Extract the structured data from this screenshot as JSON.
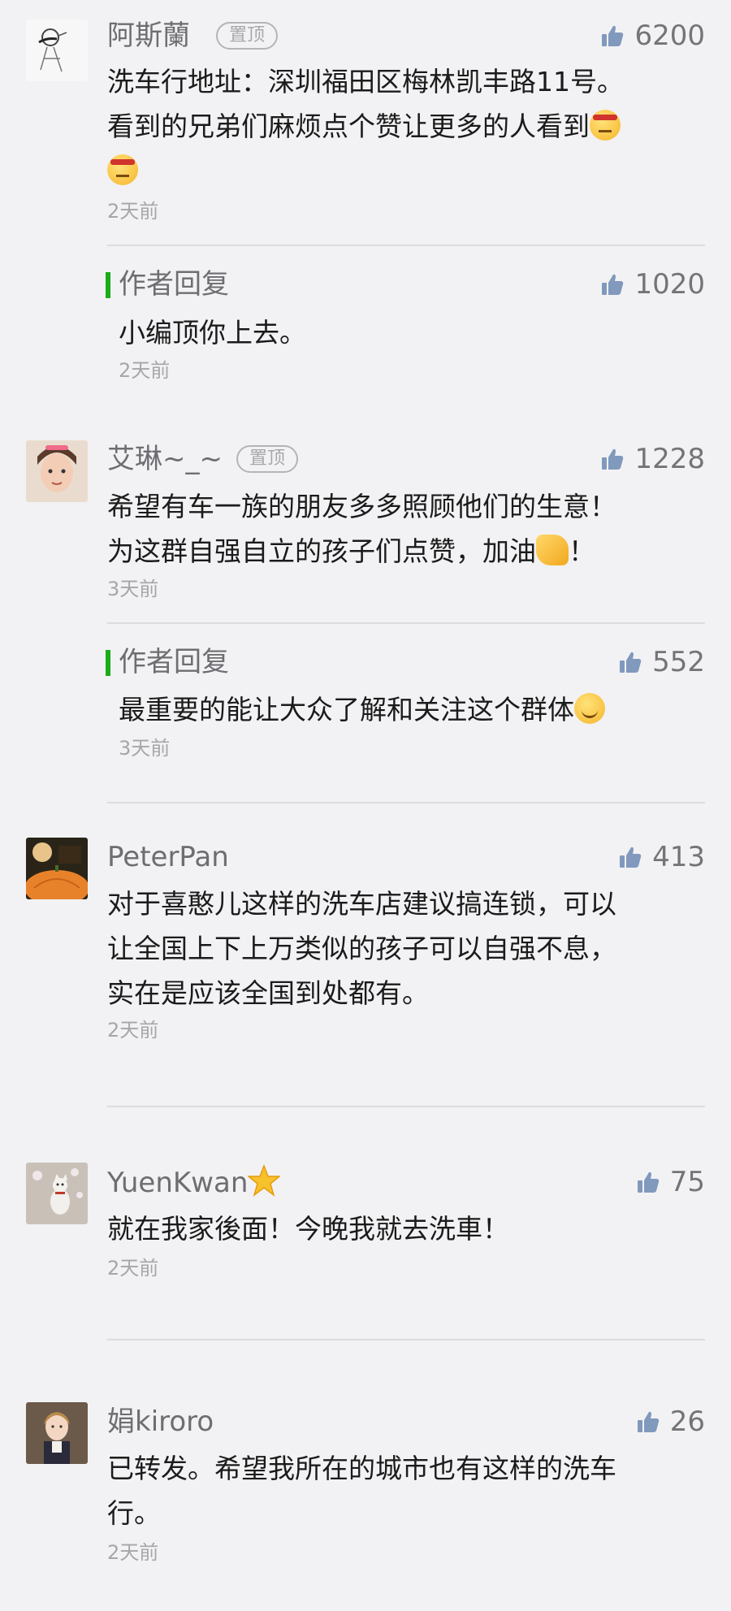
{
  "comments": [
    {
      "name": "阿斯蘭",
      "pin": "置顶",
      "likes": "6200",
      "text_line1": "洗车行地址：深圳福田区梅林凯丰路11号。",
      "text_line2": "看到的兄弟们麻烦点个赞让更多的人看到",
      "time": "2天前",
      "avatar_icon": "sketch-avatar-icon"
    },
    {
      "name": "艾琳~_~",
      "pin": "置顶",
      "likes": "1228",
      "text_line1": "希望有车一族的朋友多多照顾他们的生意！",
      "text_line2": "为这群自强自立的孩子们点赞，加油",
      "text_line2_tail": "！",
      "time": "3天前",
      "avatar_icon": "girl-avatar-icon"
    },
    {
      "name": "PeterPan",
      "likes": "413",
      "text_line1": "对于喜憨儿这样的洗车店建议搞连锁，可以",
      "text_line2": "让全国上下上万类似的孩子可以自强不息，",
      "text_line3": "实在是应该全国到处都有。",
      "time": "2天前",
      "avatar_icon": "pumpkin-avatar-icon"
    },
    {
      "name": "YuenKwan",
      "likes": "75",
      "text_line1": "就在我家後面！今晚我就去洗車！",
      "time": "2天前",
      "avatar_icon": "cat-avatar-icon"
    },
    {
      "name": "娟kiroro",
      "likes": "26",
      "text_line1": "已转发。希望我所在的城市也有这样的洗车",
      "text_line2": "行。",
      "time": "2天前",
      "avatar_icon": "child-avatar-icon"
    }
  ],
  "replies": [
    {
      "label": "作者回复",
      "likes": "1020",
      "text": "小编顶你上去。",
      "time": "2天前"
    },
    {
      "label": "作者回复",
      "likes": "552",
      "text": "最重要的能让大众了解和关注这个群体",
      "time": "3天前"
    }
  ],
  "icons": {
    "like": "thumbs-up-icon",
    "reply_marker": "green-bar"
  },
  "colors": {
    "background": "#f2f2f4",
    "reply_bar": "#1aad19",
    "thumb": "#8099bd"
  }
}
